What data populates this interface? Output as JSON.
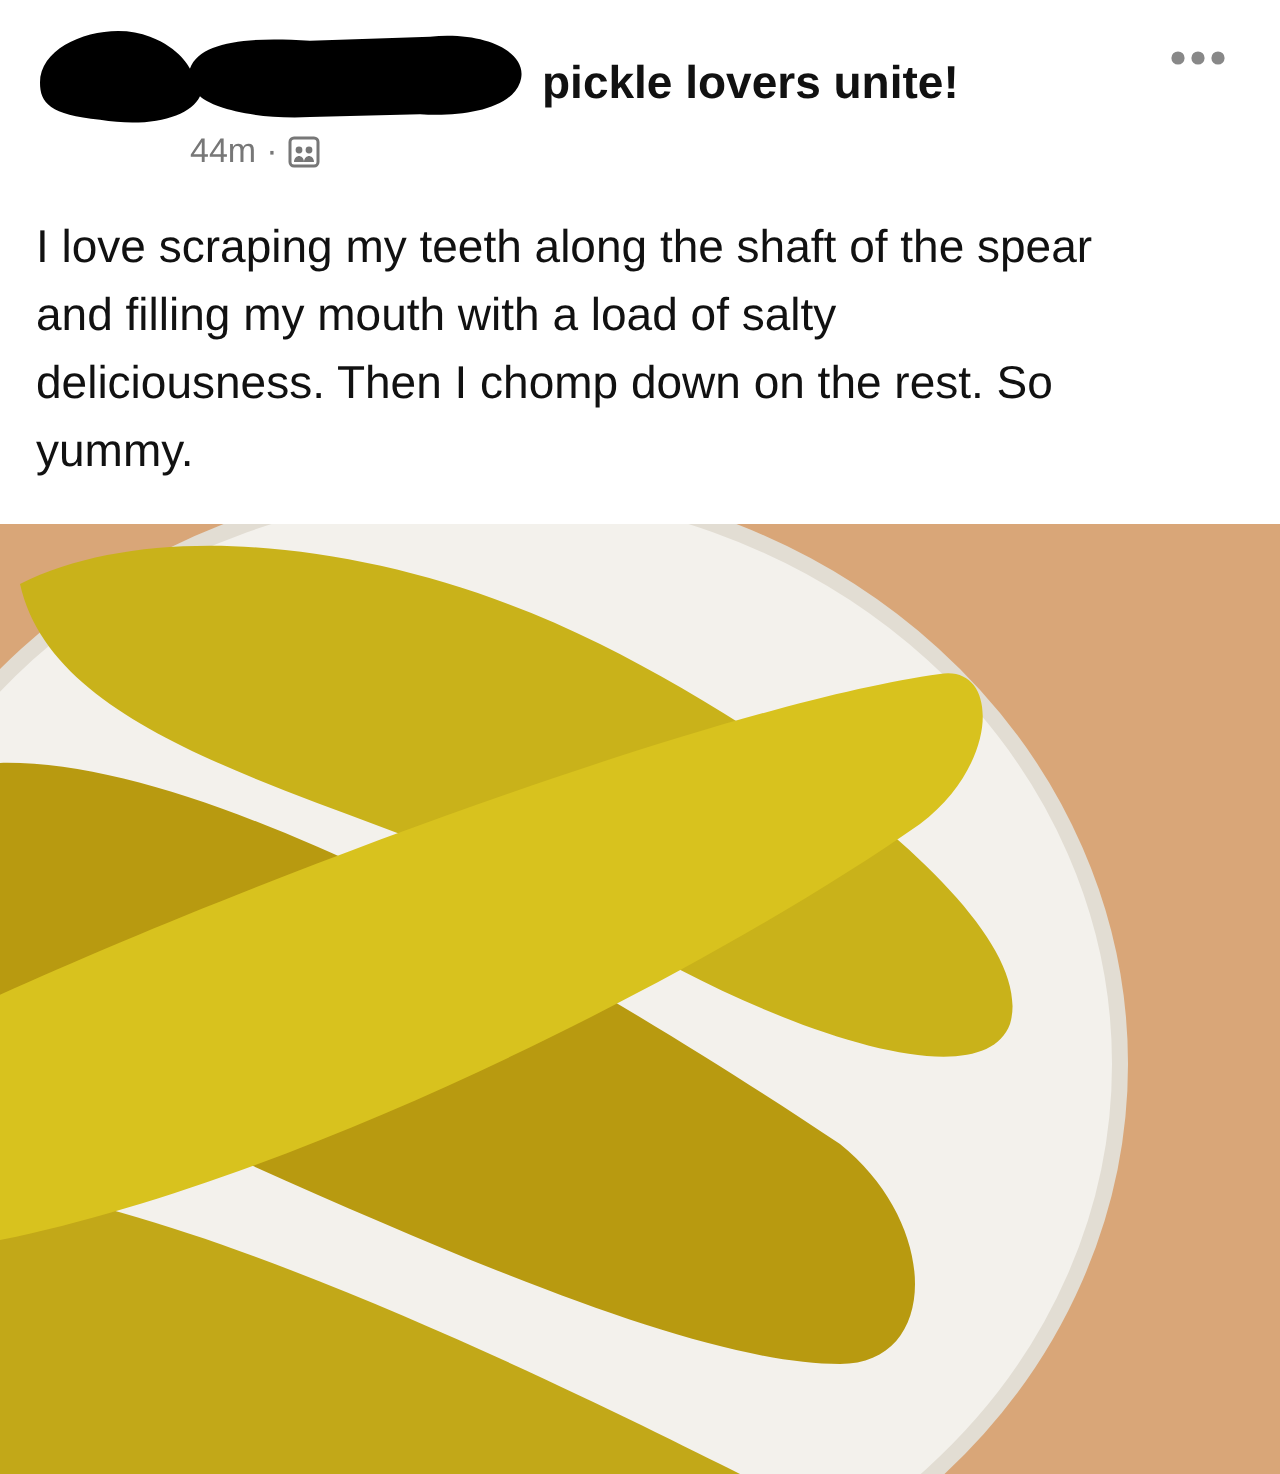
{
  "post": {
    "group": "pickle lovers unite!",
    "time": "44m",
    "separator": "·",
    "body": "I love scraping my teeth along the shaft of the spear and filling my mouth with a load of salty deliciousness. Then I chomp down on the rest. So yummy."
  }
}
